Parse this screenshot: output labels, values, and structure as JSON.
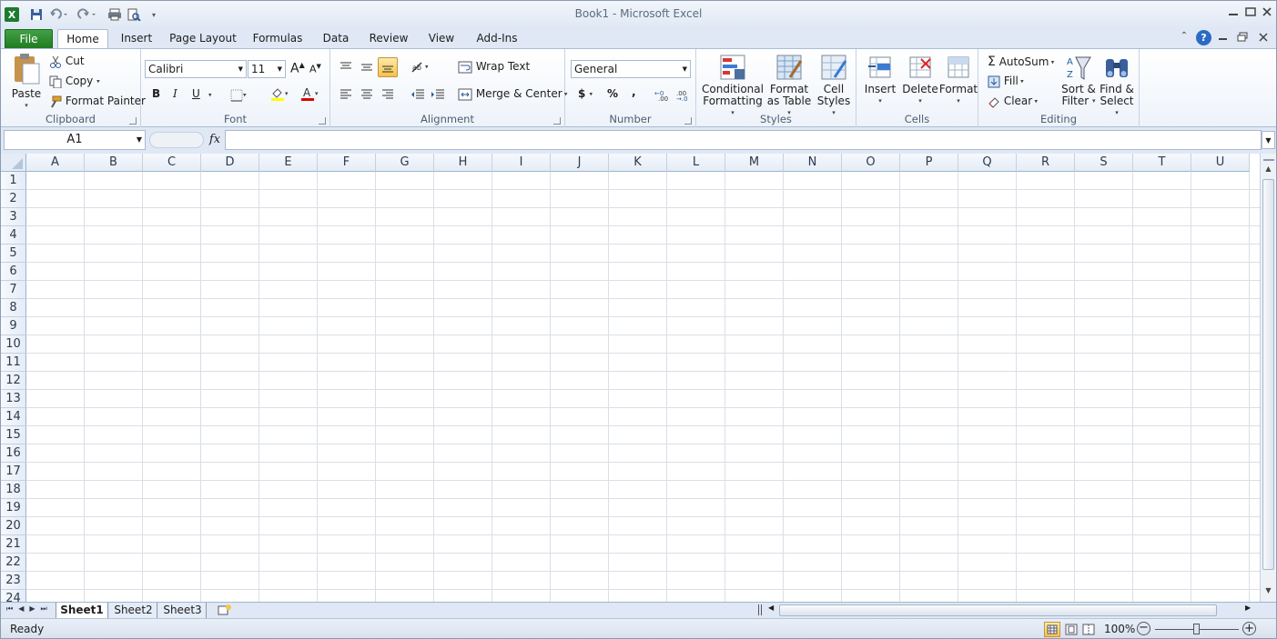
{
  "window": {
    "title": "Book1  -  Microsoft Excel"
  },
  "tabs": [
    "File",
    "Home",
    "Insert",
    "Page Layout",
    "Formulas",
    "Data",
    "Review",
    "View",
    "Add-Ins"
  ],
  "clipboard": {
    "paste": "Paste",
    "cut": "Cut",
    "copy": "Copy",
    "format_painter": "Format Painter",
    "label": "Clipboard"
  },
  "font": {
    "name": "Calibri",
    "size": "11",
    "bold": "B",
    "italic": "I",
    "underline": "U",
    "label": "Font"
  },
  "alignment": {
    "wrap": "Wrap Text",
    "merge": "Merge & Center",
    "label": "Alignment"
  },
  "number": {
    "format": "General",
    "currency": "$",
    "percent": "%",
    "comma": ",",
    "label": "Number"
  },
  "styles": {
    "conditional_1": "Conditional",
    "conditional_2": "Formatting",
    "table_1": "Format",
    "table_2": "as Table",
    "cell_1": "Cell",
    "cell_2": "Styles",
    "label": "Styles"
  },
  "cells": {
    "insert": "Insert",
    "delete": "Delete",
    "format": "Format",
    "label": "Cells"
  },
  "editing": {
    "autosum": "AutoSum",
    "fill": "Fill",
    "clear": "Clear",
    "sort_1": "Sort &",
    "sort_2": "Filter",
    "find_1": "Find &",
    "find_2": "Select",
    "label": "Editing"
  },
  "formula_bar": {
    "name_box": "A1",
    "fx": "fx"
  },
  "columns": [
    "A",
    "B",
    "C",
    "D",
    "E",
    "F",
    "G",
    "H",
    "I",
    "J",
    "K",
    "L",
    "M",
    "N",
    "O",
    "P",
    "Q",
    "R",
    "S",
    "T",
    "U"
  ],
  "rows": [
    "1",
    "2",
    "3",
    "4",
    "5",
    "6",
    "7",
    "8",
    "9",
    "10",
    "11",
    "12",
    "13",
    "14",
    "15",
    "16",
    "17",
    "18",
    "19",
    "20",
    "21",
    "22",
    "23",
    "24"
  ],
  "sheets": [
    "Sheet1",
    "Sheet2",
    "Sheet3"
  ],
  "status": {
    "ready": "Ready",
    "zoom": "100%"
  }
}
